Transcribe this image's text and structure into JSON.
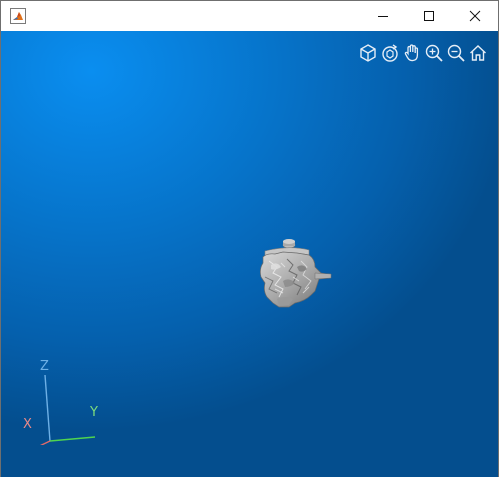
{
  "window": {
    "title": "",
    "controls": {
      "minimize": "minimize",
      "maximize": "maximize",
      "close": "close"
    }
  },
  "toolbar": {
    "tools": [
      {
        "name": "restore-view-icon"
      },
      {
        "name": "rotate-icon"
      },
      {
        "name": "pan-icon"
      },
      {
        "name": "zoom-in-icon"
      },
      {
        "name": "zoom-out-icon"
      },
      {
        "name": "home-icon"
      }
    ]
  },
  "axes": {
    "x_label": "X",
    "y_label": "Y",
    "z_label": "Z",
    "colors": {
      "x": "#e88a8a",
      "y": "#7ddc7d",
      "z": "#6eb0e6"
    }
  },
  "colors": {
    "viewport_bg": "#0673c9",
    "model": "#b4b4b4"
  }
}
